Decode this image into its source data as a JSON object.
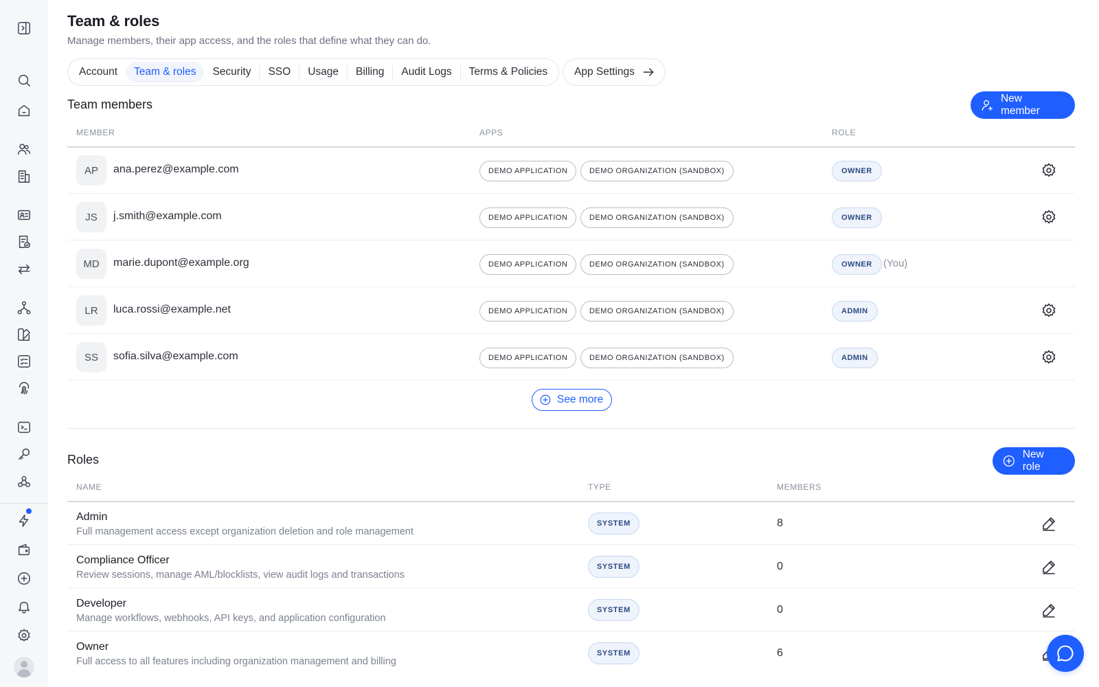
{
  "sidebar": {
    "icons": [
      "toggle-sidebar-icon",
      "search-icon",
      "home-icon",
      "users-icon",
      "building-icon",
      "id-card-icon",
      "document-check-icon",
      "transfer-icon",
      "workflow-icon",
      "palette-icon",
      "checklist-icon",
      "fingerprint-icon",
      "terminal-icon",
      "key-icon",
      "webhook-icon",
      "lightning-icon",
      "wallet-icon",
      "plus-circle-icon",
      "bell-icon",
      "gear-icon"
    ],
    "notification_dot_color": "#1f5eff"
  },
  "page": {
    "title": "Team & roles",
    "subtitle": "Manage members, their app access, and the roles that define what they can do."
  },
  "tabs": [
    {
      "label": "Account",
      "active": false
    },
    {
      "label": "Team & roles",
      "active": true
    },
    {
      "label": "Security",
      "active": false
    },
    {
      "label": "SSO",
      "active": false
    },
    {
      "label": "Usage",
      "active": false
    },
    {
      "label": "Billing",
      "active": false
    },
    {
      "label": "Audit Logs",
      "active": false
    },
    {
      "label": "Terms & Policies",
      "active": false
    }
  ],
  "app_settings_label": "App Settings",
  "team": {
    "title": "Team members",
    "new_button": "New member",
    "columns": {
      "member": "MEMBER",
      "apps": "APPS",
      "role": "ROLE"
    },
    "members": [
      {
        "initials": "AP",
        "email": "ana.perez@example.com",
        "apps": [
          "DEMO APPLICATION",
          "DEMO ORGANIZATION (SANDBOX)"
        ],
        "role": "OWNER",
        "you": ""
      },
      {
        "initials": "JS",
        "email": "j.smith@example.com",
        "apps": [
          "DEMO APPLICATION",
          "DEMO ORGANIZATION (SANDBOX)"
        ],
        "role": "OWNER",
        "you": ""
      },
      {
        "initials": "MD",
        "email": "marie.dupont@example.org",
        "apps": [
          "DEMO APPLICATION",
          "DEMO ORGANIZATION (SANDBOX)"
        ],
        "role": "OWNER",
        "you": "(You)"
      },
      {
        "initials": "LR",
        "email": "luca.rossi@example.net",
        "apps": [
          "DEMO APPLICATION",
          "DEMO ORGANIZATION (SANDBOX)"
        ],
        "role": "ADMIN",
        "you": ""
      },
      {
        "initials": "SS",
        "email": "sofia.silva@example.com",
        "apps": [
          "DEMO APPLICATION",
          "DEMO ORGANIZATION (SANDBOX)"
        ],
        "role": "ADMIN",
        "you": ""
      }
    ],
    "see_more": "See more"
  },
  "roles": {
    "title": "Roles",
    "new_button": "New role",
    "columns": {
      "name": "NAME",
      "type": "TYPE",
      "members": "MEMBERS"
    },
    "items": [
      {
        "name": "Admin",
        "description": "Full management access except organization deletion and role management",
        "type": "SYSTEM",
        "members": "8"
      },
      {
        "name": "Compliance Officer",
        "description": "Review sessions, manage AML/blocklists, view audit logs and transactions",
        "type": "SYSTEM",
        "members": "0"
      },
      {
        "name": "Developer",
        "description": "Manage workflows, webhooks, API keys, and application configuration",
        "type": "SYSTEM",
        "members": "0"
      },
      {
        "name": "Owner",
        "description": "Full access to all features including organization management and billing",
        "type": "SYSTEM",
        "members": "6"
      }
    ]
  },
  "colors": {
    "accent": "#1f5eff",
    "chip_bg": "#eef3fc",
    "sidebar_bg": "#f6f7f9"
  }
}
